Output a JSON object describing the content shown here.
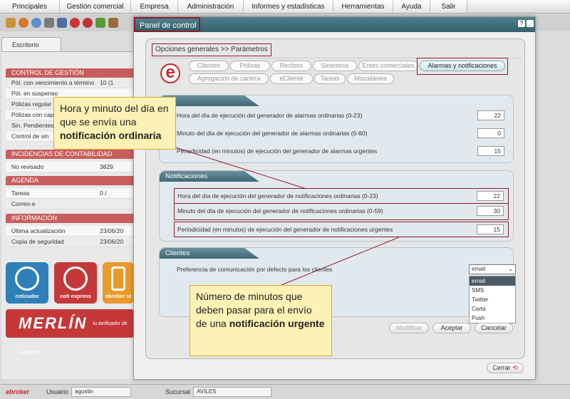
{
  "menu": [
    "Principales",
    "Gestión comercial",
    "Empresa",
    "Administración",
    "Informes y estadísticas",
    "Herramientas",
    "Ayuda",
    "Salir"
  ],
  "background": {
    "tab_label": "Escritorio",
    "control": {
      "title": "CONTROL DE GESTIÓN",
      "rows": [
        {
          "label": "Pól. con vencimiento a término",
          "value": "10 (1"
        },
        {
          "label": "Pól. en suspenso",
          "value": ""
        },
        {
          "label": "Pólizas regular",
          "value": ""
        },
        {
          "label": "Pólizas con cap",
          "value": ""
        },
        {
          "label": "Sin. Pendientes",
          "value": ""
        },
        {
          "label": "Control de sin",
          "value": ""
        }
      ]
    },
    "incidencias": {
      "title": "INCIDENCIAS DE CONTABILIDAD",
      "rows": [
        {
          "label": "No revisado",
          "value": "3829"
        }
      ]
    },
    "agenda": {
      "title": "AGENDA",
      "rows": [
        {
          "label": "Tareas",
          "value": "0 /"
        },
        {
          "label": "Correo-e",
          "value": ""
        }
      ]
    },
    "info": {
      "title": "INFORMACIÓN",
      "rows": [
        {
          "label": "Última actualización",
          "value": "23/06/20"
        },
        {
          "label": "Copia de seguridad",
          "value": "23/06/20"
        }
      ]
    },
    "buttons": [
      "cotizador",
      "coti express",
      "ebroker st"
    ],
    "merlin": "MERLÍN",
    "merlin_tag": "tu tarificador de confianza"
  },
  "status": {
    "logo": "ebroker",
    "user_label": "Usuario",
    "user_value": "agustin",
    "branch_label": "Sucursal",
    "branch_value": "AVILES"
  },
  "modal": {
    "title": "Panel de control",
    "breadcrumb": "Opciones generales >> Parámetros",
    "tabs_row1": [
      "Clientes",
      "Pólizas",
      "Recibos",
      "Siniestros",
      "Entes comerciales",
      "Alarmas y notificaciones"
    ],
    "tabs_row2": [
      "Agregación de cartera",
      "eCliente",
      "Tareas",
      "Miscelánea"
    ],
    "alarmas": {
      "rows": [
        {
          "label": "Hora del día de ejecución del generador de alarmas ordinarias (0-23)",
          "value": "22"
        },
        {
          "label": "Minuto del día de ejecución del generador de alarmas ordinarias (0-60)",
          "value": "0"
        },
        {
          "label": "Periodicidad (en minutos) de ejecución del generador de alarmas urgentes",
          "value": "15"
        }
      ]
    },
    "notificaciones": {
      "title": "Notificaciones",
      "rows": [
        {
          "label": "Hora del día de ejecución del generador de notificaciones ordinarias (0-23)",
          "value": "22"
        },
        {
          "label": "Minuto del día de ejecución del generador de notificaciones ordinarias (0-59)",
          "value": "30"
        },
        {
          "label": "Periodicidad (en minutos) de ejecución del generador de notificaciones urgentes",
          "value": "15"
        }
      ]
    },
    "clientes": {
      "title": "Clientes",
      "label": "Preferencia de comunicación por defecto para los clientes",
      "selected": "email",
      "options": [
        "email",
        "SMS",
        "Twitter",
        "Carta",
        "Push"
      ]
    },
    "buttons": {
      "modify": "Modificar",
      "accept": "Aceptar",
      "cancel": "Cancelar",
      "close": "Cerrar"
    }
  },
  "callouts": {
    "top": {
      "pre": "Hora y minuto del día en que se envía una ",
      "bold": "notificación ordinaria"
    },
    "bottom": {
      "pre": "Número de minutos que deben pasar para el envío de una ",
      "bold": "notificación urgente"
    }
  }
}
